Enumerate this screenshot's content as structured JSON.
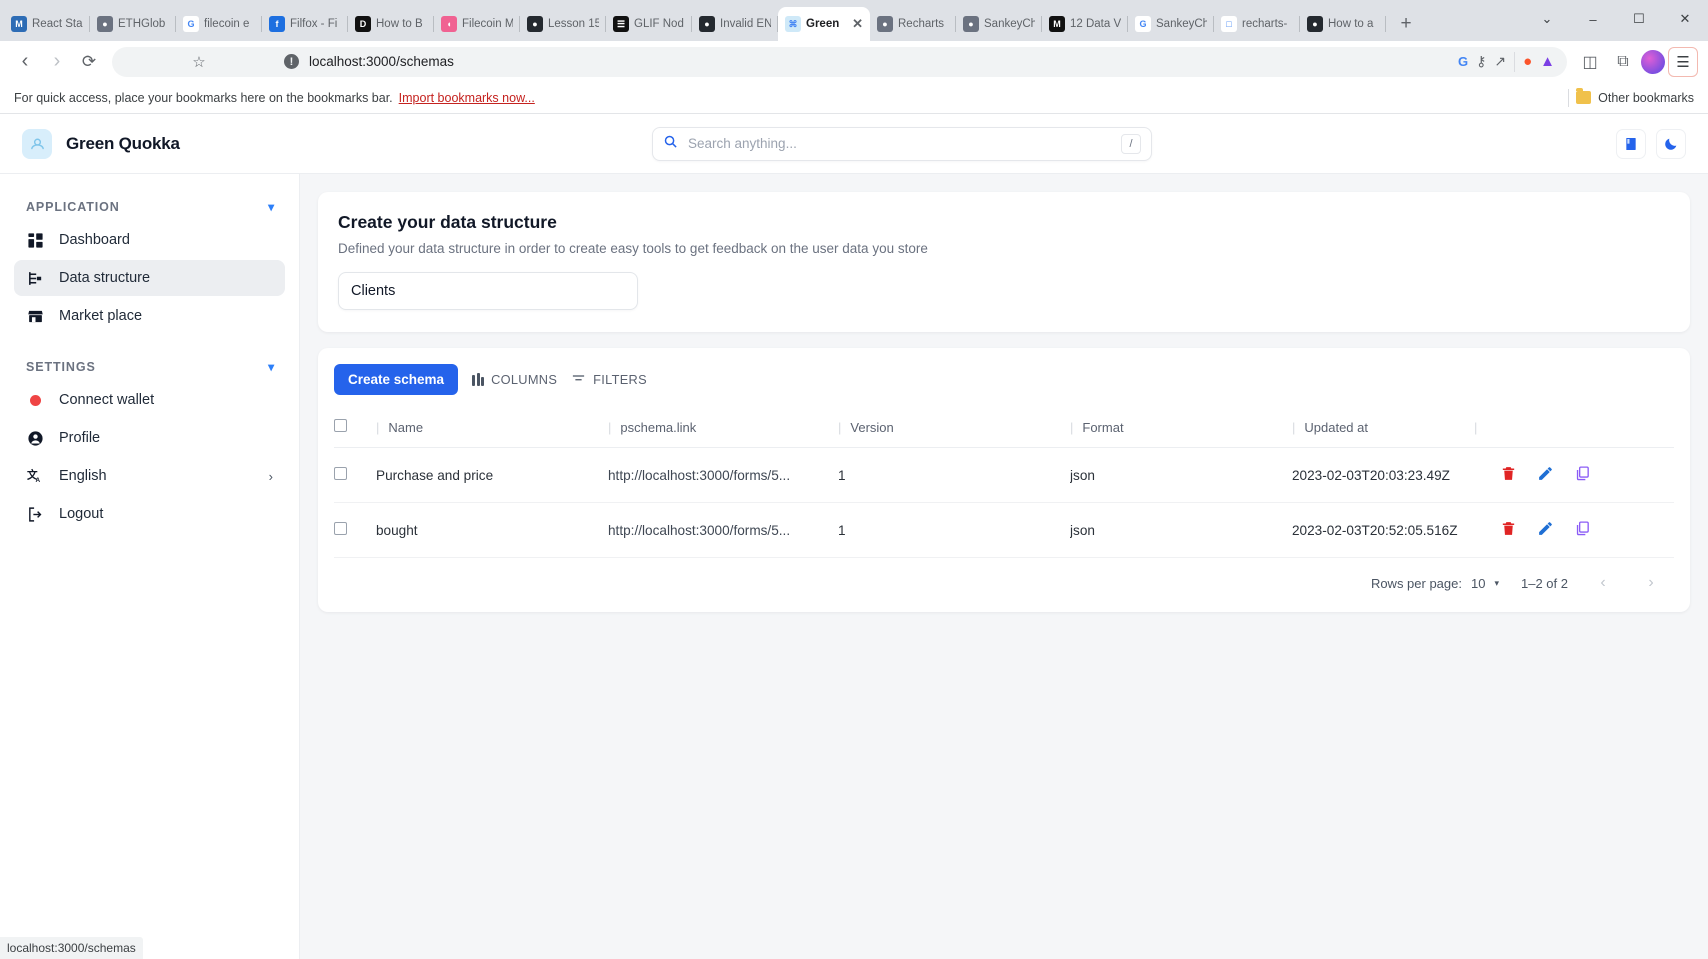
{
  "browser": {
    "tabs": [
      {
        "label": "React Sta",
        "favicon": "reactstack-icon",
        "color": "#2d6cb5",
        "glyph": "M",
        "active": false
      },
      {
        "label": "ETHGlob",
        "favicon": "ethglobal-icon",
        "color": "#6b7280",
        "glyph": "●",
        "active": false
      },
      {
        "label": "filecoin e",
        "favicon": "google-icon",
        "color": "#ffffff",
        "glyph": "G",
        "active": false
      },
      {
        "label": "Filfox - Fi",
        "favicon": "filfox-icon",
        "color": "#1d6fe0",
        "glyph": "f",
        "active": false
      },
      {
        "label": "How to B",
        "favicon": "dd-icon",
        "color": "#111111",
        "glyph": "D",
        "active": false
      },
      {
        "label": "Filecoin M",
        "favicon": "filecoin-icon",
        "color": "#f06292",
        "glyph": "◖",
        "active": false
      },
      {
        "label": "Lesson 15",
        "favicon": "github-icon",
        "color": "#24292f",
        "glyph": "●",
        "active": false
      },
      {
        "label": "GLIF Nod",
        "favicon": "glif-icon",
        "color": "#111111",
        "glyph": "☰",
        "active": false
      },
      {
        "label": "Invalid EN",
        "favicon": "github-icon",
        "color": "#24292f",
        "glyph": "●",
        "active": false
      },
      {
        "label": "Green",
        "favicon": "quokka-icon",
        "color": "#cfe9f8",
        "glyph": "⌘",
        "active": true
      },
      {
        "label": "Recharts",
        "favicon": "globe-icon",
        "color": "#6b7280",
        "glyph": "●",
        "active": false
      },
      {
        "label": "SankeyCh",
        "favicon": "globe-icon",
        "color": "#6b7280",
        "glyph": "●",
        "active": false
      },
      {
        "label": "12 Data V",
        "favicon": "medium-icon",
        "color": "#111111",
        "glyph": "M",
        "active": false
      },
      {
        "label": "SankeyCh",
        "favicon": "google-icon",
        "color": "#ffffff",
        "glyph": "G",
        "active": false
      },
      {
        "label": "recharts-",
        "favicon": "page-icon",
        "color": "#ffffff",
        "glyph": "□",
        "active": false
      },
      {
        "label": "How to a",
        "favicon": "github-icon",
        "color": "#24292f",
        "glyph": "●",
        "active": false
      }
    ],
    "new_tab_label": "+",
    "tab_close_label": "✕",
    "window_controls": {
      "minimize": "–",
      "maximize": "☐",
      "close": "✕",
      "expand": "⌄"
    },
    "nav": {
      "back": "‹",
      "forward": "›",
      "reload": "⟳",
      "bookmark_star": "☆"
    },
    "omnibox": {
      "url": "localhost:3000/schemas",
      "security_glyph": "!"
    },
    "omnibox_icons": [
      {
        "name": "google-lens-icon",
        "glyph": "G"
      },
      {
        "name": "password-key-icon",
        "glyph": "⚷"
      },
      {
        "name": "share-icon",
        "glyph": "↗"
      },
      {
        "name": "brave-shield-icon",
        "glyph": "▼"
      },
      {
        "name": "metamask-icon",
        "glyph": "▲"
      }
    ],
    "toolbar_right": [
      {
        "name": "sidepanel-icon",
        "glyph": "◫"
      },
      {
        "name": "extensions-icon",
        "glyph": "⧉"
      }
    ],
    "menu_glyph": "☰",
    "bookmarks_bar": {
      "message": "For quick access, place your bookmarks here on the bookmarks bar.",
      "import_link": "Import bookmarks now...",
      "other_bookmarks": "Other bookmarks"
    },
    "status_bar": "localhost:3000/schemas"
  },
  "app": {
    "brand": "Green Quokka",
    "search": {
      "placeholder": "Search anything...",
      "value": "",
      "shortcut": "/"
    },
    "header_actions": [
      {
        "name": "docs-button",
        "glyph": "▌▌"
      },
      {
        "name": "dark-mode-toggle",
        "glyph": "☾"
      }
    ]
  },
  "sidebar": {
    "sections": [
      {
        "title": "APPLICATION",
        "collapse_glyph": "⌄",
        "items": [
          {
            "label": "Dashboard",
            "icon": "dashboard-icon",
            "active": false
          },
          {
            "label": "Data structure",
            "icon": "data-structure-icon",
            "active": true
          },
          {
            "label": "Market place",
            "icon": "store-icon",
            "active": false
          }
        ]
      },
      {
        "title": "SETTINGS",
        "collapse_glyph": "⌄",
        "items": [
          {
            "label": "Connect wallet",
            "icon": "wallet-status-dot-icon",
            "active": false
          },
          {
            "label": "Profile",
            "icon": "person-icon",
            "active": false
          },
          {
            "label": "English",
            "icon": "translate-icon",
            "active": false,
            "arrow": "›"
          },
          {
            "label": "Logout",
            "icon": "logout-icon",
            "active": false
          }
        ]
      }
    ]
  },
  "main": {
    "create_card": {
      "title": "Create your data structure",
      "subtitle": "Defined your data structure in order to create easy tools to get feedback on the user data you store",
      "input_value": "Clients",
      "input_placeholder": ""
    },
    "toolbar": {
      "create_schema_label": "Create schema",
      "columns_label": "COLUMNS",
      "filters_label": "FILTERS"
    },
    "table": {
      "divider_glyph": "|",
      "columns": [
        "Name",
        "pschema.link",
        "Version",
        "Format",
        "Updated at"
      ],
      "rows": [
        {
          "name": "Purchase and price",
          "link": "http://localhost:3000/forms/5...",
          "version": "1",
          "format": "json",
          "updated_at": "2023-02-03T20:03:23.49Z"
        },
        {
          "name": "bought",
          "link": "http://localhost:3000/forms/5...",
          "version": "1",
          "format": "json",
          "updated_at": "2023-02-03T20:52:05.516Z"
        }
      ],
      "row_actions": [
        {
          "name": "delete-row-button",
          "color": "#e02424"
        },
        {
          "name": "edit-row-button",
          "color": "#1f6fd4"
        },
        {
          "name": "duplicate-row-button",
          "color": "#8b5cf6"
        }
      ]
    },
    "pagination": {
      "rows_per_page_label": "Rows per page:",
      "rows_per_page_value": "10",
      "caret_glyph": "▼",
      "range_label": "1–2 of 2",
      "prev_glyph": "‹",
      "next_glyph": "›"
    }
  },
  "colors": {
    "primary": "#2563eb",
    "danger": "#e02424",
    "edit": "#1f6fd4",
    "duplicate": "#8b5cf6",
    "sidebar_active": "#eceef1",
    "canvas": "#f5f6f8"
  }
}
